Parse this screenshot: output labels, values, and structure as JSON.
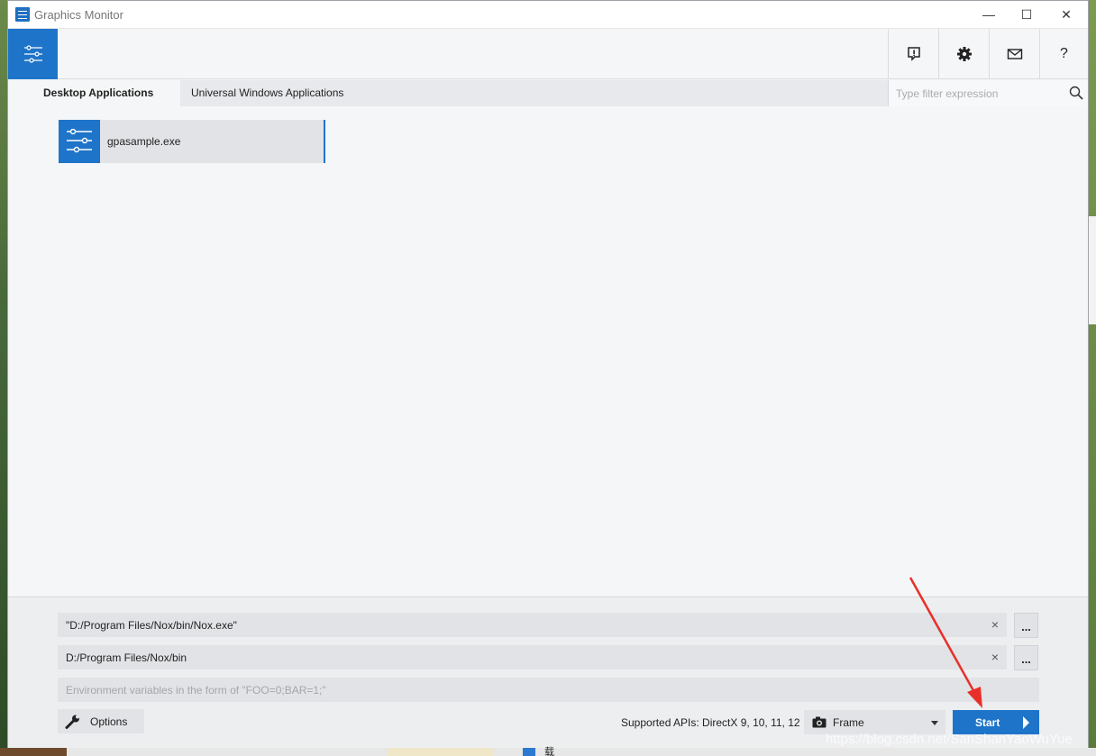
{
  "window": {
    "title": "Graphics Monitor",
    "controls": {
      "minimize": "—",
      "maximize": "☐",
      "close": "✕"
    }
  },
  "toolbar": {
    "home_icon": "sliders-icon",
    "buttons": [
      {
        "name": "feedback",
        "icon": "feedback-icon"
      },
      {
        "name": "settings",
        "icon": "gear-icon"
      },
      {
        "name": "mail",
        "icon": "mail-icon"
      },
      {
        "name": "help",
        "label": "?"
      }
    ]
  },
  "tabs": [
    {
      "label": "Desktop Applications",
      "active": true
    },
    {
      "label": "Universal Windows Applications",
      "active": false
    }
  ],
  "filter": {
    "placeholder": "Type filter expression"
  },
  "applications": [
    {
      "label": "gpasample.exe",
      "icon": "sliders-icon"
    }
  ],
  "launch": {
    "executable": "\"D:/Program Files/Nox/bin/Nox.exe\"",
    "working_dir": "D:/Program Files/Nox/bin",
    "env_placeholder": "Environment variables in the form of \"FOO=0;BAR=1;\"",
    "browse_label": "...",
    "clear_label": "×"
  },
  "footer": {
    "options_label": "Options",
    "apis_text": "Supported APIs: DirectX 9, 10, 11, 12",
    "capture_mode": "Frame",
    "start_label": "Start"
  },
  "watermark": "https://blog.csdn.net/SanShanYaoWuYue",
  "colors": {
    "accent": "#1e74c8",
    "background": "#f5f6f7",
    "annotation": "#e8302a"
  }
}
